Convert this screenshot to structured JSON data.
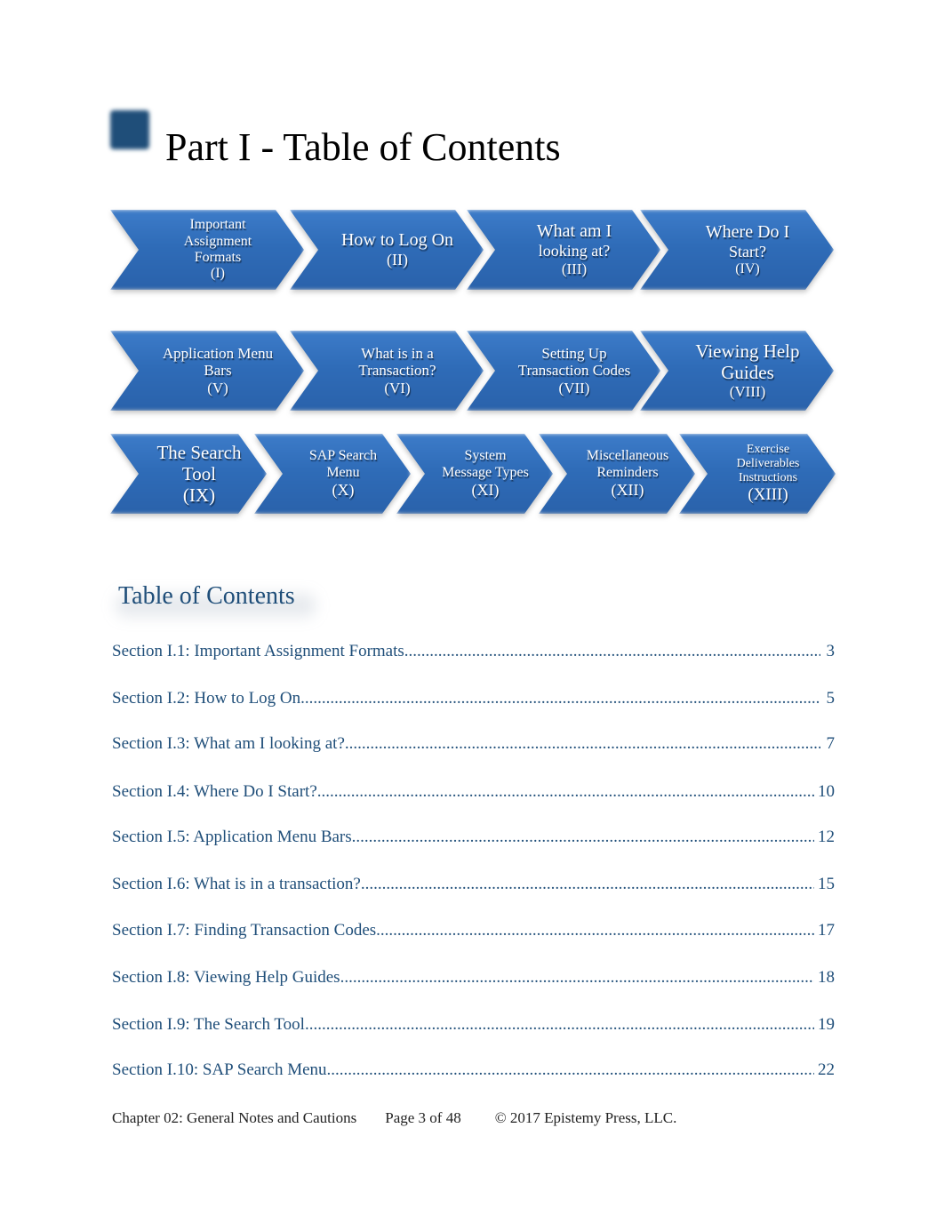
{
  "header": {
    "title": "Part I - Table of Contents",
    "accent_color": "#1f4e79"
  },
  "flow": {
    "arrow_color": "#2f6cb8",
    "rows": [
      [
        {
          "lines": [
            "Important",
            "Assignment",
            "Formats"
          ],
          "numeral": "(I)"
        },
        {
          "lines": [
            "How to Log On"
          ],
          "numeral": "(II)"
        },
        {
          "lines": [
            "What am I",
            "looking at?"
          ],
          "numeral": "(III)"
        },
        {
          "lines": [
            "Where Do I",
            "Start?"
          ],
          "numeral": "(IV)"
        }
      ],
      [
        {
          "lines": [
            "Application Menu",
            "Bars"
          ],
          "numeral": "(V)"
        },
        {
          "lines": [
            "What is in a",
            "Transaction?"
          ],
          "numeral": "(VI)"
        },
        {
          "lines": [
            "Setting Up",
            "Transaction Codes"
          ],
          "numeral": "(VII)"
        },
        {
          "lines": [
            "Viewing Help",
            "Guides"
          ],
          "numeral": "(VIII)"
        }
      ],
      [
        {
          "lines": [
            "The Search",
            "Tool"
          ],
          "numeral": "(IX)"
        },
        {
          "lines": [
            "SAP Search",
            "Menu"
          ],
          "numeral": "(X)"
        },
        {
          "lines": [
            "System",
            "Message Types"
          ],
          "numeral": "(XI)"
        },
        {
          "lines": [
            "Miscellaneous",
            "Reminders"
          ],
          "numeral": "(XII)"
        },
        {
          "lines": [
            "Exercise",
            "Deliverables",
            "Instructions"
          ],
          "numeral": "(XIII)"
        }
      ]
    ]
  },
  "toc": {
    "heading": "Table of Contents",
    "entries": [
      {
        "title": "Section I.1: Important Assignment Formats",
        "page": "3"
      },
      {
        "title": "Section I.2: How to Log On",
        "page": "5"
      },
      {
        "title": "Section I.3: What am I looking at?",
        "page": "7"
      },
      {
        "title": "Section I.4: Where Do I Start?",
        "page": "10"
      },
      {
        "title": "Section I.5: Application Menu Bars",
        "page": "12"
      },
      {
        "title": "Section I.6: What is in a transaction?",
        "page": "15"
      },
      {
        "title": "Section I.7: Finding Transaction Codes",
        "page": "17"
      },
      {
        "title": "Section I.8: Viewing Help Guides",
        "page": "18"
      },
      {
        "title": "Section I.9: The Search Tool",
        "page": "19"
      },
      {
        "title": "Section I.10: SAP Search Menu",
        "page": "22"
      }
    ]
  },
  "footer": {
    "chapter": "Chapter 02: General Notes and Cautions",
    "page": "Page 3 of 48",
    "copyright": "© 2017 Epistemy Press, LLC."
  }
}
